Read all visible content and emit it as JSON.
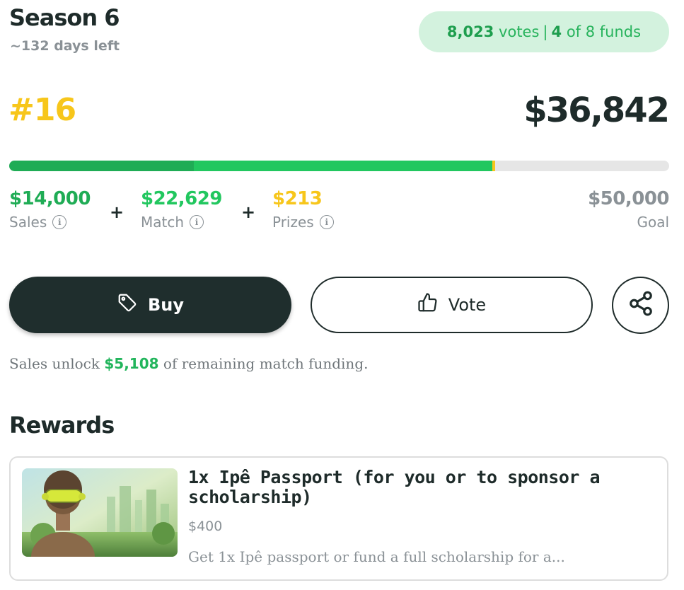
{
  "header": {
    "title": "Season 6",
    "days_left": "~132 days left",
    "votes_count": "8,023",
    "votes_word": "votes",
    "funds_count": "4",
    "funds_text": "of 8 funds"
  },
  "summary": {
    "rank": "#16",
    "total": "$36,842"
  },
  "progress": {
    "goal": 50000,
    "sales": 14000,
    "match": 22629,
    "prizes": 213,
    "colors": {
      "sales": "#1fac55",
      "match": "#22c75f",
      "prizes": "#f7c61b",
      "track": "#e6e6e6"
    }
  },
  "breakdown": {
    "sales_value": "$14,000",
    "sales_label": "Sales",
    "match_value": "$22,629",
    "match_label": "Match",
    "prizes_value": "$213",
    "prizes_label": "Prizes",
    "plus": "+",
    "goal_value": "$50,000",
    "goal_label": "Goal",
    "colors": {
      "sales": "#1fac55",
      "match": "#22c75f",
      "prizes": "#f7c61b"
    }
  },
  "actions": {
    "buy_label": "Buy",
    "vote_label": "Vote",
    "buy_icon": "tag-icon",
    "vote_icon": "thumbs-up-icon",
    "share_icon": "share-icon"
  },
  "unlock": {
    "prefix": "Sales unlock",
    "amount": "$5,108",
    "suffix": "of remaining match funding."
  },
  "rewards": {
    "title": "Rewards",
    "items": [
      {
        "name": "1x Ipê Passport (for you or to sponsor a scholarship)",
        "price": "$400",
        "description": "Get 1x Ipê passport or fund a full scholarship for a..."
      }
    ]
  }
}
